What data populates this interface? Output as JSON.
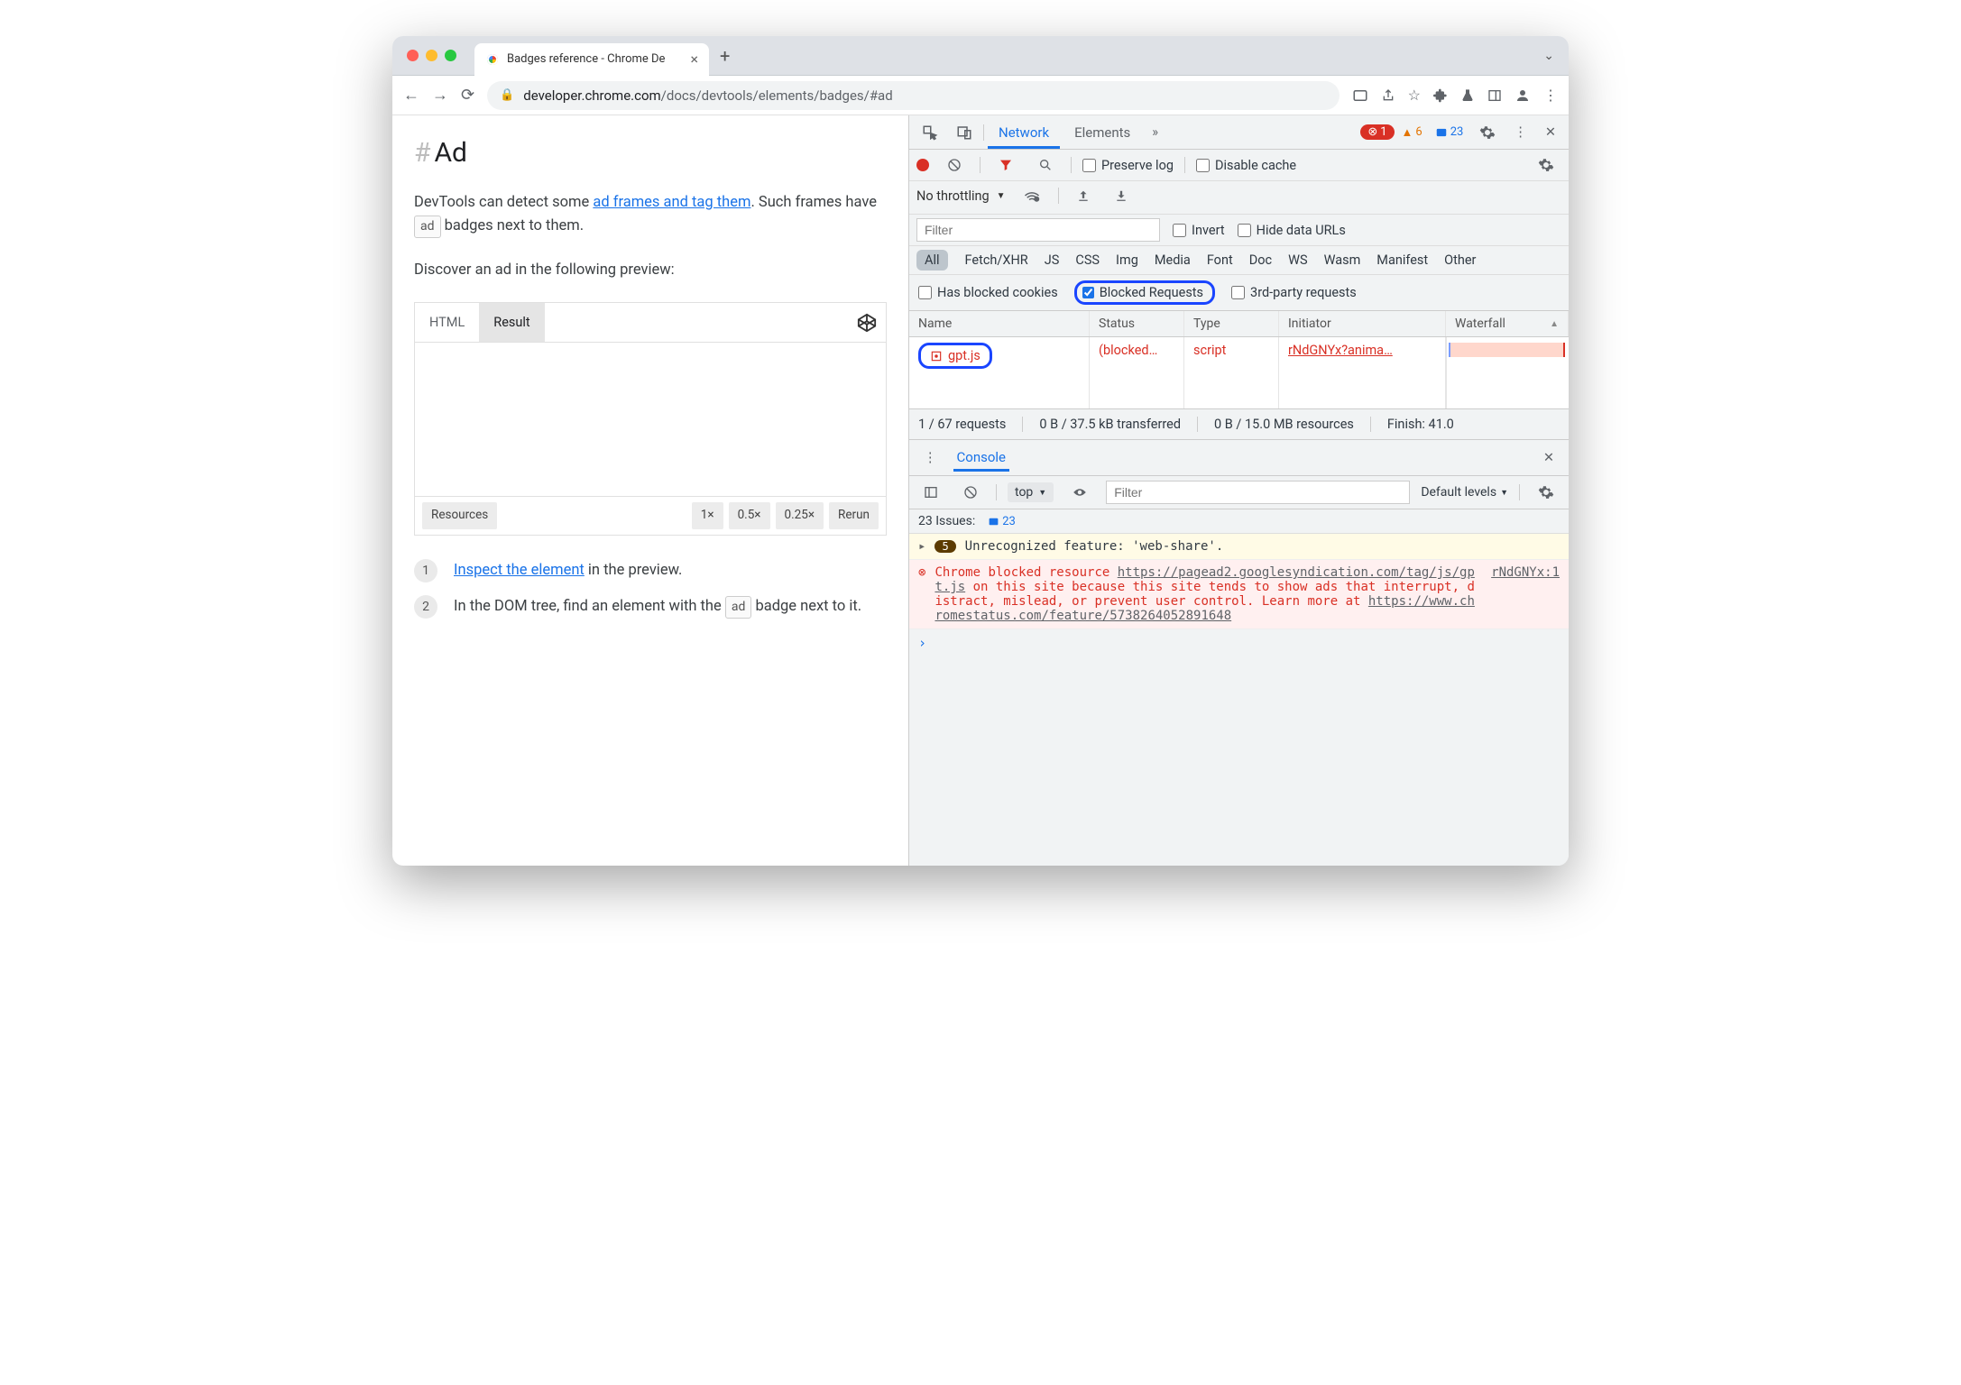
{
  "browser": {
    "tab_title": "Badges reference - Chrome De",
    "url_host": "developer.chrome.com",
    "url_path": "/docs/devtools/elements/badges/#ad"
  },
  "page": {
    "heading": "Ad",
    "para1_a": "DevTools can detect some ",
    "para1_link": "ad frames and tag them",
    "para1_b": ". Such frames have ",
    "para1_badge": "ad",
    "para1_c": " badges next to them.",
    "para2": "Discover an ad in the following preview:",
    "preview_tabs": {
      "html": "HTML",
      "result": "Result"
    },
    "preview_footer": {
      "resources": "Resources",
      "z1": "1×",
      "z05": "0.5×",
      "z025": "0.25×",
      "rerun": "Rerun"
    },
    "step1_link": "Inspect the element",
    "step1_rest": " in the preview.",
    "step2_a": "In the DOM tree, find an element with the ",
    "step2_badge": "ad",
    "step2_b": " badge next to it."
  },
  "devtools": {
    "tabs": {
      "network": "Network",
      "elements": "Elements"
    },
    "errors": "1",
    "warnings": "6",
    "info": "23",
    "preserve_log": "Preserve log",
    "disable_cache": "Disable cache",
    "throttling": "No throttling",
    "filter_placeholder": "Filter",
    "invert": "Invert",
    "hide_urls": "Hide data URLs",
    "types": {
      "all": "All",
      "fetch": "Fetch/XHR",
      "js": "JS",
      "css": "CSS",
      "img": "Img",
      "media": "Media",
      "font": "Font",
      "doc": "Doc",
      "ws": "WS",
      "wasm": "Wasm",
      "manifest": "Manifest",
      "other": "Other"
    },
    "has_blocked_cookies": "Has blocked cookies",
    "blocked_requests": "Blocked Requests",
    "third_party": "3rd-party requests",
    "columns": {
      "name": "Name",
      "status": "Status",
      "type": "Type",
      "initiator": "Initiator",
      "waterfall": "Waterfall"
    },
    "row": {
      "name": "gpt.js",
      "status": "(blocked…",
      "type": "script",
      "initiator": "rNdGNYx?anima…"
    },
    "statusbar": {
      "requests": "1 / 67 requests",
      "transferred": "0 B / 37.5 kB transferred",
      "resources": "0 B / 15.0 MB resources",
      "finish": "Finish: 41.0"
    },
    "console": {
      "title": "Console",
      "top": "top",
      "filter_placeholder": "Filter",
      "levels": "Default levels",
      "issues_label": "23 Issues:",
      "issues_count": "23",
      "warn_count": "5",
      "warn_msg": "Unrecognized feature: 'web-share'.",
      "err_pre": "Chrome blocked resource ",
      "err_url": "https://pagead2.googlesyndication.com/tag/js/gpt.js",
      "err_mid": " on this site because this site tends to show ads that interrupt, distract, mislead, or prevent user control. Learn more at ",
      "err_learn": "https://www.chromestatus.com/feature/5738264052891648",
      "err_source": "rNdGNYx:1"
    }
  }
}
